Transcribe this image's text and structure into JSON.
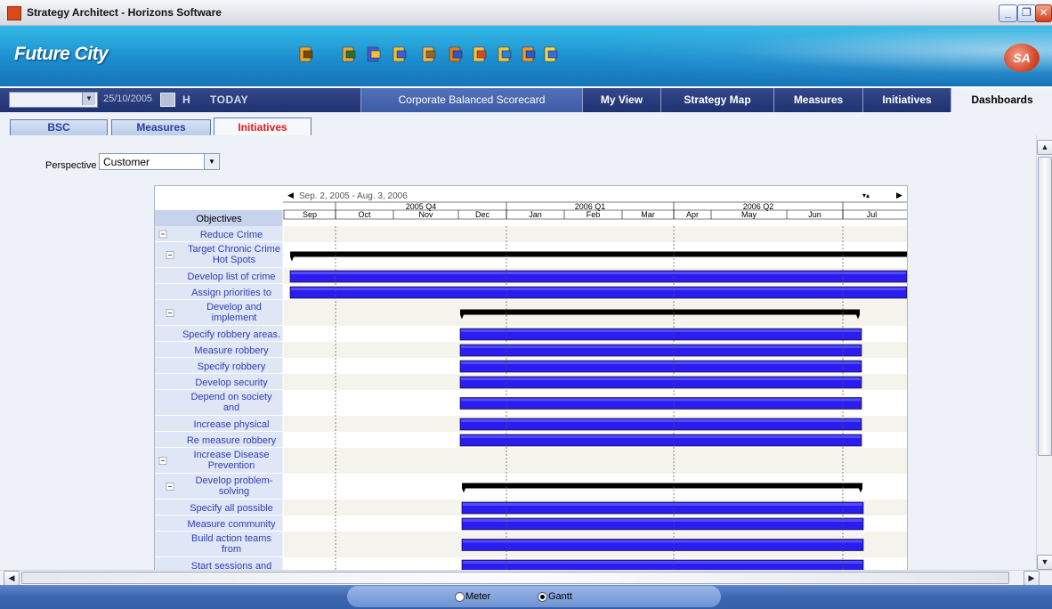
{
  "window": {
    "title": "Strategy Architect - Horizons Software"
  },
  "banner": {
    "brand": "Future City",
    "logo_text": "SA",
    "toolbar_icons": [
      "runner-icon",
      "export-icon",
      "back-icon",
      "forward-icon",
      "report-icon",
      "book-icon",
      "search-report-icon",
      "transfer-icon",
      "web-icon",
      "lightbulb-icon"
    ]
  },
  "nav": {
    "date_value": "25/10/2005",
    "h_label": "H",
    "today_label": "TODAY",
    "tabs": [
      {
        "label": "Corporate Balanced Scorecard"
      },
      {
        "label": "My View"
      },
      {
        "label": "Strategy Map"
      },
      {
        "label": "Measures"
      },
      {
        "label": "Initiatives"
      },
      {
        "label": "Dashboards"
      }
    ]
  },
  "subtabs": [
    {
      "label": "BSC"
    },
    {
      "label": "Measures"
    },
    {
      "label": "Initiatives"
    }
  ],
  "perspective": {
    "label": "Perspective :",
    "value": "Customer"
  },
  "gantt": {
    "range_label": "Sep. 2, 2005 - Aug. 3, 2006",
    "objectives_header": "Objectives",
    "quarters": [
      "2005 Q4",
      "2006 Q1",
      "2006 Q2"
    ],
    "months": [
      "Sep",
      "Oct",
      "Nov",
      "Dec",
      "Jan",
      "Feb",
      "Mar",
      "Apr",
      "May",
      "Jun",
      "Jul"
    ],
    "rows": [
      {
        "label": [
          "Reduce Crime"
        ],
        "expander": true,
        "level": 0
      },
      {
        "label": [
          "Target Chronic Crime",
          "Hot Spots"
        ],
        "expander": true,
        "level": 1
      },
      {
        "label": [
          "Develop list of crime"
        ],
        "level": 2
      },
      {
        "label": [
          "Assign priorities to"
        ],
        "level": 2
      },
      {
        "label": [
          "Develop and",
          "implement"
        ],
        "expander": true,
        "level": 1
      },
      {
        "label": [
          "Specify robbery areas."
        ],
        "level": 2
      },
      {
        "label": [
          "Measure robbery"
        ],
        "level": 2
      },
      {
        "label": [
          "Specify robbery"
        ],
        "level": 2
      },
      {
        "label": [
          "Develop security"
        ],
        "level": 2
      },
      {
        "label": [
          "Depend on society",
          "and"
        ],
        "level": 2
      },
      {
        "label": [
          "Increase physical"
        ],
        "level": 2
      },
      {
        "label": [
          "Re measure robbery"
        ],
        "level": 2
      },
      {
        "label": [
          "Increase Disease",
          "Prevention"
        ],
        "expander": true,
        "level": 0
      },
      {
        "label": [
          "Develop problem-",
          "solving"
        ],
        "expander": true,
        "level": 1
      },
      {
        "label": [
          "Specify all possible"
        ],
        "level": 2
      },
      {
        "label": [
          "Measure community"
        ],
        "level": 2
      },
      {
        "label": [
          "Build action teams",
          "from"
        ],
        "level": 2
      },
      {
        "label": [
          "Start sessions and"
        ],
        "level": 2
      }
    ]
  },
  "footer": {
    "options": [
      {
        "label": "Meter",
        "selected": false
      },
      {
        "label": "Gantt",
        "selected": true
      }
    ]
  },
  "colors": {
    "task_bar": "#2b1cf0",
    "summary_bar": "#000000",
    "banner": "#1c8ecf",
    "nav": "#25377a"
  }
}
